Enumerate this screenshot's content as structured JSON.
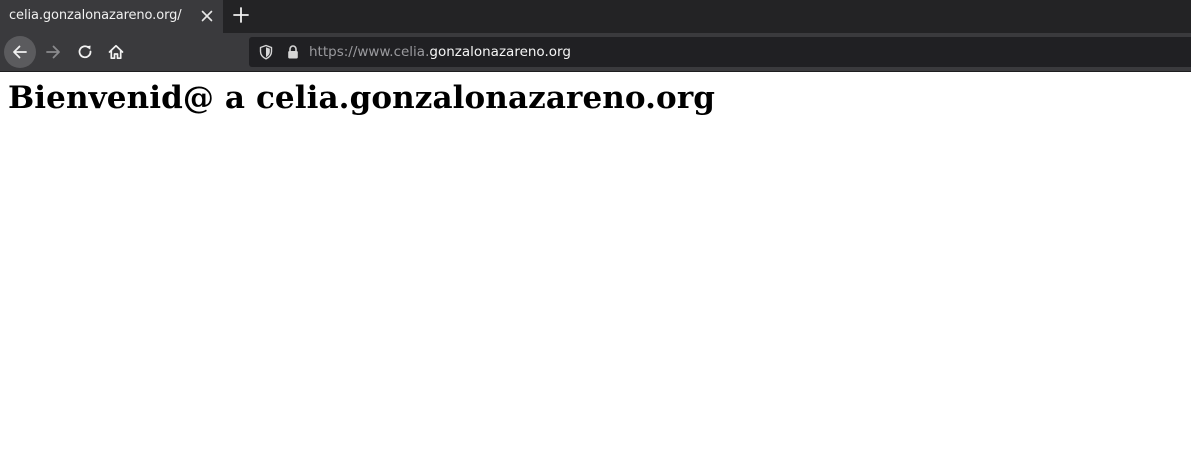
{
  "tab": {
    "title": "celia.gonzalonazareno.org/"
  },
  "urlbar": {
    "prefix": "https://www.celia.",
    "domain": "gonzalonazareno.org"
  },
  "icons": {
    "tab_close": "close-icon",
    "new_tab": "plus-icon",
    "back": "arrow-left-icon",
    "forward": "arrow-right-icon",
    "reload": "reload-icon",
    "home": "home-icon",
    "tracking": "shield-icon",
    "secure": "lock-icon"
  },
  "colors": {
    "tabstrip": "#232325",
    "toolbar": "#3a3a3d",
    "urlbar": "#202023",
    "page_background": "#ffffff",
    "heading_text": "#000000"
  },
  "page": {
    "heading": "Bienvenid@ a celia.gonzalonazareno.org"
  }
}
